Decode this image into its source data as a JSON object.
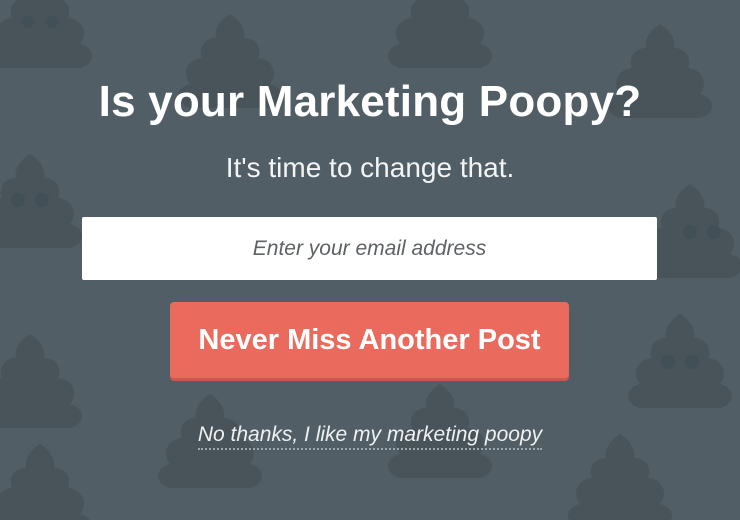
{
  "popup": {
    "headline": "Is your Marketing Poopy?",
    "subheadline": "It's time to change that.",
    "email_placeholder": "Enter your email address",
    "cta_label": "Never Miss Another Post",
    "decline_label": "No thanks, I like my marketing poopy"
  },
  "colors": {
    "background": "#525e65",
    "pattern_icon": "#48545a",
    "cta": "#ea6a5e",
    "text": "#ffffff"
  },
  "icons": {
    "background_pattern": "poop-emoji-icon"
  }
}
